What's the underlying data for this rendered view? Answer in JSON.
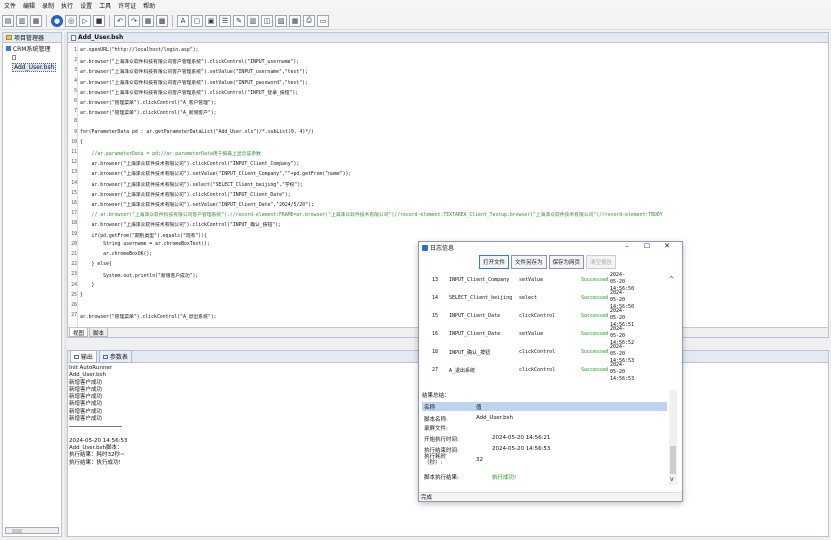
{
  "menu": [
    "文件",
    "编辑",
    "录制",
    "执行",
    "设置",
    "工具",
    "许可证",
    "帮助"
  ],
  "toolbar_icons": [
    "new-icon",
    "open-icon",
    "save-icon",
    "record-icon",
    "play-icon",
    "step-icon",
    "stop-icon",
    "undo-icon",
    "redo-icon",
    "grid-icon",
    "table-icon",
    "text-icon",
    "doc-icon",
    "page-icon",
    "list-icon",
    "comment-icon",
    "form-icon",
    "code-icon",
    "image-icon",
    "report-icon",
    "print-icon",
    "window-icon"
  ],
  "left": {
    "tab": "项目管理器",
    "tree": [
      "CRM系统管理",
      "Add_User.bsh"
    ]
  },
  "editor": {
    "tab": "Add_User.bsh",
    "lines": [
      {
        "n": "1",
        "t": "ar.openURL(\"http://localhost/login.asp\");",
        "c": ""
      },
      {
        "n": "2",
        "t": "ar.browser(\"上海泽众软件科技有限公司客户管理系统\").clickControl(\"INPUT_username\");",
        "c": ""
      },
      {
        "n": "3",
        "t": "ar.browser(\"上海泽众软件科技有限公司客户管理系统\").setValue(\"INPUT_username\",\"test\");",
        "c": ""
      },
      {
        "n": "4",
        "t": "ar.browser(\"上海泽众软件科技有限公司客户管理系统\").setValue(\"INPUT_password\",\"test\");",
        "c": ""
      },
      {
        "n": "5",
        "t": "ar.browser(\"上海泽众软件科技有限公司客户管理系统\").clickControl(\"INPUT_登录_按钮\");",
        "c": ""
      },
      {
        "n": "6",
        "t": "ar.browser(\"管理菜单\").clickControl(\"A_客户管理\");",
        "c": ""
      },
      {
        "n": "7",
        "t": "ar.browser(\"管理菜单\").clickControl(\"A_新增客户\");",
        "c": ""
      },
      {
        "n": "8",
        "t": "",
        "c": ""
      },
      {
        "n": "9",
        "t": "for(ParameterData pd : ar.getParameterDataList(\"Add_User.xls\")/*.subList(0, 4)*/)",
        "c": ""
      },
      {
        "n": "10",
        "t": "{",
        "c": ""
      },
      {
        "n": "11",
        "t": "    //ar.parameterData = pd;//ar.parameterData用于报表上显示该参数",
        "c": "cm"
      },
      {
        "n": "12",
        "t": "    ar.browser(\"上海泽众软件技术有限公司\").clickControl(\"INPUT_Client_Company\");",
        "c": ""
      },
      {
        "n": "13",
        "t": "    ar.browser(\"上海泽众软件技术有限公司\").setValue(\"INPUT_Client_Company\",\"\"+pd.getFrom(\"name\"));",
        "c": ""
      },
      {
        "n": "14",
        "t": "    ar.browser(\"上海泽众软件技术有限公司\").select(\"SELECT_Client_beijing\",\"学校\");",
        "c": ""
      },
      {
        "n": "15",
        "t": "    ar.browser(\"上海泽众软件技术有限公司\").clickControl(\"INPUT_Client_Date\");",
        "c": ""
      },
      {
        "n": "16",
        "t": "    ar.browser(\"上海泽众软件技术有限公司\").setValue(\"INPUT_Client_Date\",\"2024/5/20\");",
        "c": ""
      },
      {
        "n": "17",
        "t": "    // ar.browser(\"上海泽众软件科技有限公司客户管理系统\").//record-element:FRAME=ar.browser(\"上海泽众软件技术有限公司\")//record-element:TEXTAREA_Client_Testup.browser(\"上海泽众软件技术有限公司\")//record-element:TBODY",
        "c": "cm"
      },
      {
        "n": "18",
        "t": "    ar.browser(\"上海泽众软件技术有限公司\").clickControl(\"INPUT_确认_按钮\");",
        "c": ""
      },
      {
        "n": "19",
        "t": "    if(pd.getFrom(\"期别类型\").equals(\"现有\")){",
        "c": ""
      },
      {
        "n": "20",
        "t": "        String username = ar.chromeBoxText();",
        "c": ""
      },
      {
        "n": "21",
        "t": "        ar.chromeBoxOK();",
        "c": ""
      },
      {
        "n": "22",
        "t": "    } else{",
        "c": ""
      },
      {
        "n": "23",
        "t": "        System.out.println(\"新增客户成功\");",
        "c": ""
      },
      {
        "n": "24",
        "t": "    }",
        "c": ""
      },
      {
        "n": "25",
        "t": "}",
        "c": ""
      },
      {
        "n": "26",
        "t": "",
        "c": ""
      },
      {
        "n": "27",
        "t": "ar.browser(\"管理菜单\").clickControl(\"A_退出系统\");",
        "c": ""
      }
    ],
    "bottom_tabs": [
      "视图",
      "脚本"
    ]
  },
  "output": {
    "tabs": [
      "输出",
      "参数表"
    ],
    "lines_a": [
      "Init AutoRunner",
      "Add_User.bsh",
      "新增客户成功",
      "新增客户成功",
      "新增客户成功",
      "新增客户成功",
      "新增客户成功",
      "新增客户成功"
    ],
    "lines_b": [
      "2024-05-20 14:56:53",
      "Add_User.bsh脚本：",
      "执行结果：耗时32秒~",
      "执行结果：执行成功!"
    ]
  },
  "dialog": {
    "title": "日志信息",
    "buttons": [
      "打开文件",
      "文件另存为",
      "保存为网页",
      "清空报告"
    ],
    "rows": [
      {
        "no": "13",
        "name": "INPUT_Client_Company",
        "act": "setValue",
        "res": "Successed",
        "d": "2024-05-20",
        "t": "14:56:50"
      },
      {
        "no": "14",
        "name": "SELECT_Client_beijing",
        "act": "select",
        "res": "Successed",
        "d": "2024-05-20",
        "t": "14:56:50"
      },
      {
        "no": "15",
        "name": "INPUT_Client_Date",
        "act": "clickControl",
        "res": "Successed",
        "d": "2024-05-20",
        "t": "14:56:51"
      },
      {
        "no": "16",
        "name": "INPUT_Client_Date",
        "act": "setValue",
        "res": "Successed",
        "d": "2024-05-20",
        "t": "14:56:52"
      },
      {
        "no": "18",
        "name": "INPUT_确认_按钮",
        "act": "clickControl",
        "res": "Successed",
        "d": "2024-05-20",
        "t": "14:56:53"
      },
      {
        "no": "27",
        "name": "A_退出系统",
        "act": "clickControl",
        "res": "Successed",
        "d": "2024-05-20",
        "t": "14:56:53"
      }
    ],
    "summary_title": "结果总结：",
    "summary_head": {
      "k": "名称",
      "v": "值"
    },
    "summary": [
      {
        "k": "脚本名称:",
        "v": "Add_User.bsh"
      },
      {
        "k": "录屏文件:",
        "v": ""
      },
      {
        "k": "开始执行时间:",
        "v": "2024-05-20 14:56:21"
      },
      {
        "k": "执行结束时间:",
        "v": "2024-05-20 14:56:53"
      },
      {
        "k": "执行耗时（秒）:",
        "v": "32"
      },
      {
        "k": "脚本执行结果:",
        "v": "执行成功!"
      }
    ],
    "status": "完成"
  }
}
